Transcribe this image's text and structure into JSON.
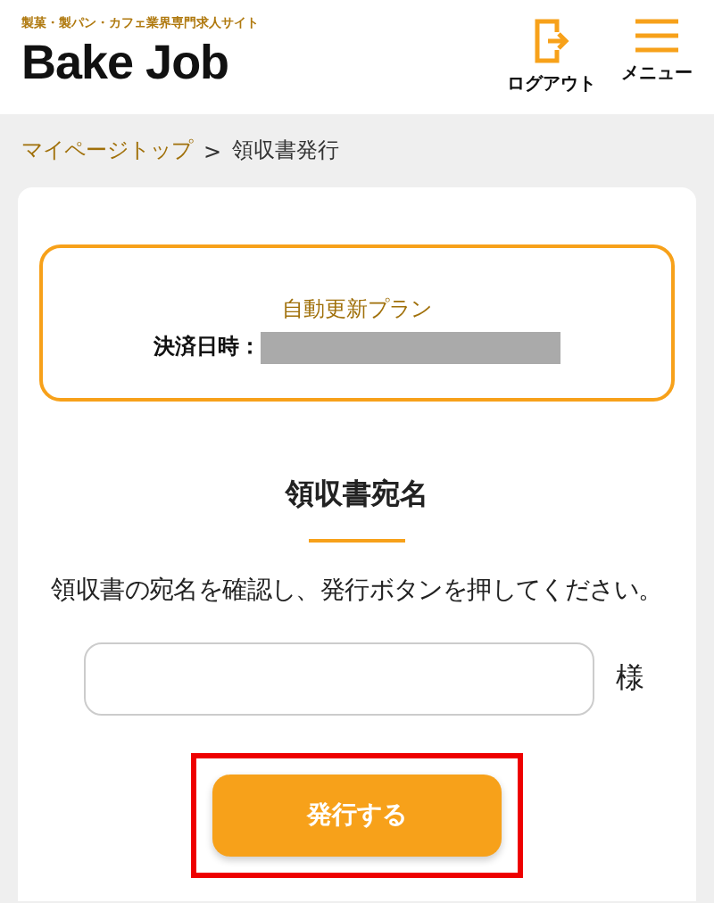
{
  "header": {
    "tagline": "製菓・製パン・カフェ業界専門求人サイト",
    "logo": "Bake Job",
    "actions": [
      {
        "kind": "logout",
        "label": "ログアウト"
      },
      {
        "kind": "menu",
        "label": "メニュー"
      }
    ]
  },
  "breadcrumb": {
    "link": "マイページトップ",
    "separator": ">",
    "current": "領収書発行"
  },
  "plan": {
    "name": "自動更新プラン",
    "date_label": "決済日時："
  },
  "form": {
    "heading": "領収書宛名",
    "instruction": "領収書の宛名を確認し、発行ボタンを押してください。",
    "suffix": "様",
    "button": "発行する",
    "highlighted": true
  }
}
